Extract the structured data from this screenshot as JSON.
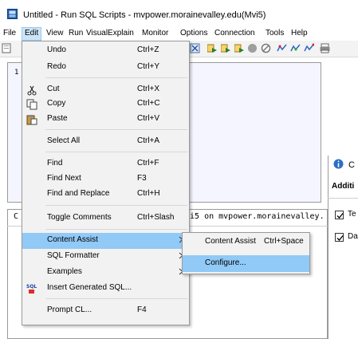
{
  "window": {
    "title": "Untitled - Run SQL Scripts - mvpower.morainevalley.edu(Mvi5)",
    "icon": "run-sql-scripts-icon"
  },
  "menubar": {
    "items": [
      "File",
      "Edit",
      "View",
      "Run",
      "VisualExplain",
      "Monitor",
      "Options",
      "Connection",
      "Tools",
      "Help"
    ],
    "active": "Edit"
  },
  "editor": {
    "line_number": "1"
  },
  "messages": {
    "left_fragment": "C",
    "visible_text": "vi5 on mvpower.morainevalley."
  },
  "edit_menu": {
    "items": [
      {
        "label": "Undo",
        "shortcut": "Ctrl+Z",
        "icon": ""
      },
      {
        "label": "Redo",
        "shortcut": "Ctrl+Y",
        "icon": ""
      },
      {
        "label": "Cut",
        "shortcut": "Ctrl+X",
        "icon": "scissors-icon"
      },
      {
        "label": "Copy",
        "shortcut": "Ctrl+C",
        "icon": "copy-icon"
      },
      {
        "label": "Paste",
        "shortcut": "Ctrl+V",
        "icon": "paste-icon"
      },
      {
        "label": "Select All",
        "shortcut": "Ctrl+A",
        "icon": ""
      },
      {
        "label": "Find",
        "shortcut": "Ctrl+F",
        "icon": ""
      },
      {
        "label": "Find Next",
        "shortcut": "F3",
        "icon": ""
      },
      {
        "label": "Find and Replace",
        "shortcut": "Ctrl+H",
        "icon": ""
      },
      {
        "label": "Toggle Comments",
        "shortcut": "Ctrl+Slash",
        "icon": ""
      },
      {
        "label": "Content Assist",
        "shortcut": "",
        "icon": "",
        "submenu": true,
        "highlighted": true
      },
      {
        "label": "SQL Formatter",
        "shortcut": "",
        "icon": "",
        "submenu": true
      },
      {
        "label": "Examples",
        "shortcut": "",
        "icon": "",
        "submenu": true
      },
      {
        "label": "Insert Generated SQL...",
        "shortcut": "",
        "icon": "sql-icon"
      },
      {
        "label": "Prompt CL...",
        "shortcut": "F4",
        "icon": ""
      }
    ]
  },
  "content_assist_submenu": {
    "items": [
      {
        "label": "Content Assist",
        "shortcut": "Ctrl+Space"
      },
      {
        "label": "Configure...",
        "shortcut": "",
        "highlighted": true
      }
    ]
  },
  "dialog": {
    "title_fragment": "C",
    "heading_fragment": "Additi",
    "checkbox_labels": [
      "Te",
      "Da"
    ],
    "checked": [
      true,
      true
    ]
  },
  "colors": {
    "highlight": "#91c9f7",
    "menu_bg": "#f2f2f2",
    "editor_bg": "#f5f5ff"
  }
}
